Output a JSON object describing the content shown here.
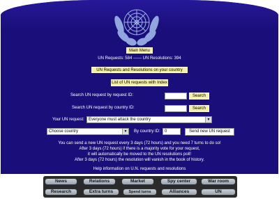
{
  "main_menu_label": "Main Menu",
  "stats_line": "UN Requests: 584 ------ UN Resolutions: 394",
  "country_requests_label": "UN Requests and Resolutions on your country",
  "list_requests_label": "List of UN requests with Index",
  "search_by_id": {
    "label": "Search UN request by request ID:",
    "value": "",
    "button": "Search"
  },
  "search_by_country": {
    "label": "Search UN request by country ID:",
    "value": "",
    "button": "Search"
  },
  "your_request": {
    "label": "Your UN request:",
    "selected": "Everyone must attack the country"
  },
  "country_select": {
    "selected": "Choose country"
  },
  "by_country_id": {
    "label": "By country ID:",
    "value": "0"
  },
  "send_button_label": "Send new UN request",
  "info_lines": [
    "You can send a new UN request every 3 days (72 hours) and you need 7 turns to do so!",
    "After 3 days (72 hours) if there is a majority vote for your request,",
    "it will automatically be moved to the UN resolutions poll!",
    "After 3 days (72 hours) the resolution will vanish in the book of history."
  ],
  "help_label": "Help information on U.N. requests and resolutions",
  "nav": {
    "row1": [
      "News",
      "Relations",
      "Market",
      "Spy center",
      "War room"
    ],
    "row2": [
      "Research",
      "Extra turns",
      "Spend turns",
      "Alliances",
      "UN"
    ]
  },
  "colors": {
    "panel": "#1a0f7a",
    "yellow": "#f4f0a4"
  }
}
